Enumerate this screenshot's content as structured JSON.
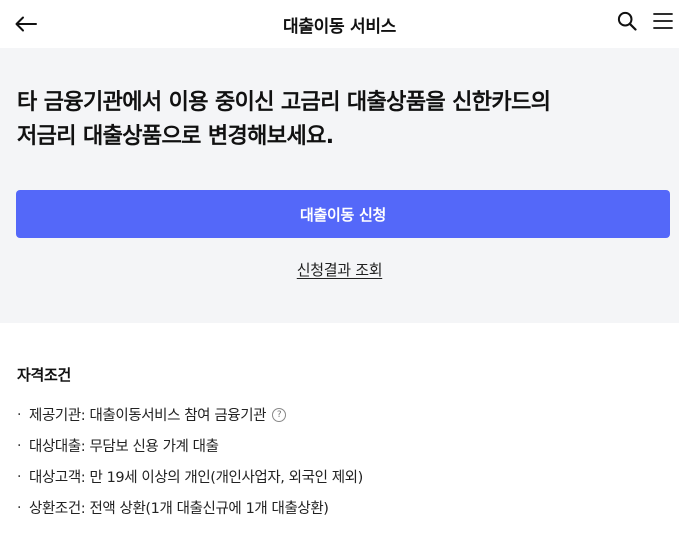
{
  "header": {
    "title": "대출이동 서비스",
    "icons": {
      "back": "arrow-left-icon",
      "search": "search-icon",
      "menu": "hamburger-menu-icon"
    }
  },
  "hero": {
    "headline_line1": "타 금융기관에서 이용 중이신 고금리 대출상품을 신한카드의",
    "headline_line2": "저금리 대출상품으로 변경해보세요.",
    "apply_button_label": "대출이동 신청",
    "result_link_label": "신청결과 조회"
  },
  "conditions": {
    "title": "자격조건",
    "items": [
      {
        "bullet": "·",
        "text": "제공기관: 대출이동서비스 참여 금융기관",
        "help": "?"
      },
      {
        "bullet": "·",
        "text": "대상대출: 무담보 신용 가계 대출"
      },
      {
        "bullet": "·",
        "text": "대상고객: 만 19세 이상의 개인(개인사업자, 외국인 제외)"
      },
      {
        "bullet": "·",
        "text": "상환조건: 전액 상환(1개 대출신규에 1개 대출상환)"
      }
    ]
  },
  "colors": {
    "accent": "#5468f9",
    "hero_bg": "#f4f5f7"
  }
}
